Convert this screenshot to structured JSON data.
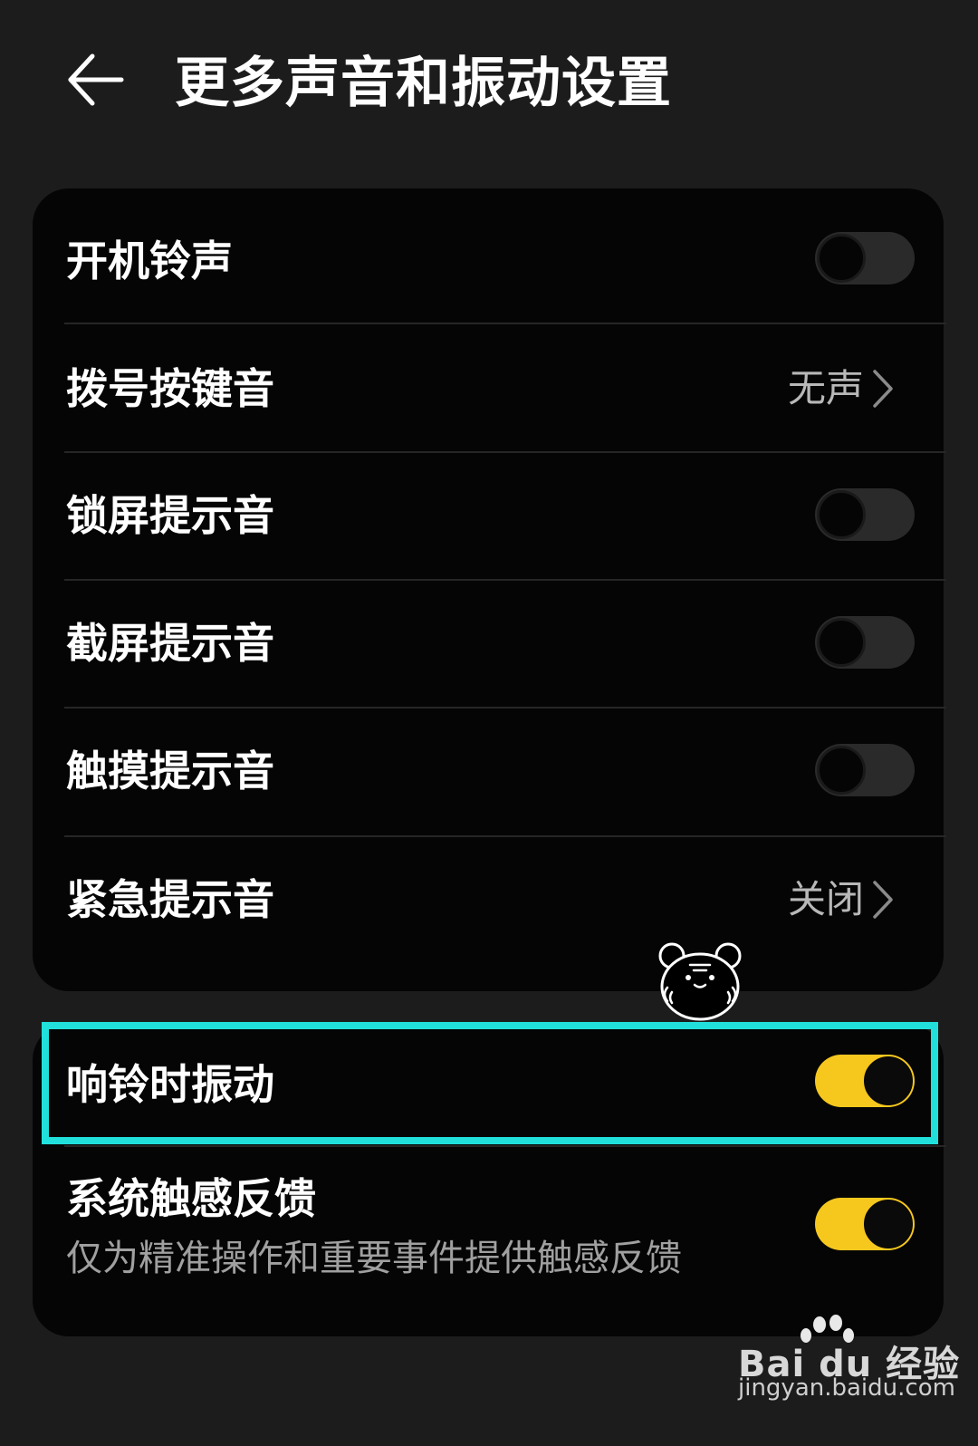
{
  "header": {
    "title": "更多声音和振动设置",
    "back_icon": "arrow-left-icon"
  },
  "settings_group_1": {
    "items": [
      {
        "label": "开机铃声",
        "type": "toggle",
        "on": false
      },
      {
        "label": "拨号按键音",
        "type": "link",
        "value": "无声"
      },
      {
        "label": "锁屏提示音",
        "type": "toggle",
        "on": false
      },
      {
        "label": "截屏提示音",
        "type": "toggle",
        "on": false
      },
      {
        "label": "触摸提示音",
        "type": "toggle",
        "on": false
      },
      {
        "label": "紧急提示音",
        "type": "link",
        "value": "关闭"
      }
    ]
  },
  "settings_group_2": {
    "items": [
      {
        "label": "响铃时振动",
        "type": "toggle",
        "on": true,
        "highlighted": true
      },
      {
        "label": "系统触感反馈",
        "subtitle": "仅为精准操作和重要事件提供触感反馈",
        "type": "toggle",
        "on": true
      }
    ]
  },
  "watermark": {
    "brand": "Bai du 经验",
    "url": "jingyan.baidu.com"
  },
  "colors": {
    "toggle_on": "#f6c81e",
    "highlight": "#21e0dc",
    "card_bg": "#050505",
    "page_bg": "#1c1c1c"
  }
}
